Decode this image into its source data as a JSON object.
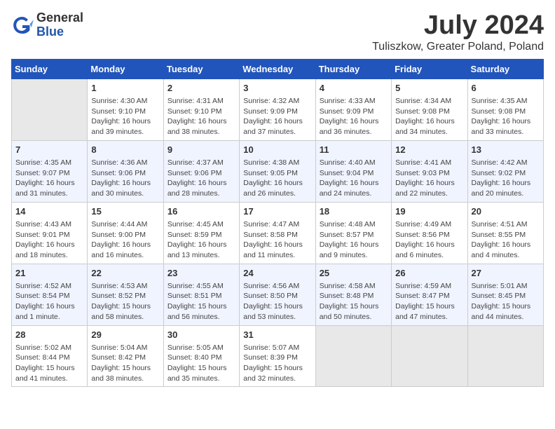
{
  "header": {
    "logo_general": "General",
    "logo_blue": "Blue",
    "month": "July 2024",
    "location": "Tuliszkow, Greater Poland, Poland"
  },
  "columns": [
    "Sunday",
    "Monday",
    "Tuesday",
    "Wednesday",
    "Thursday",
    "Friday",
    "Saturday"
  ],
  "weeks": [
    [
      {
        "day": "",
        "info": ""
      },
      {
        "day": "1",
        "info": "Sunrise: 4:30 AM\nSunset: 9:10 PM\nDaylight: 16 hours\nand 39 minutes."
      },
      {
        "day": "2",
        "info": "Sunrise: 4:31 AM\nSunset: 9:10 PM\nDaylight: 16 hours\nand 38 minutes."
      },
      {
        "day": "3",
        "info": "Sunrise: 4:32 AM\nSunset: 9:09 PM\nDaylight: 16 hours\nand 37 minutes."
      },
      {
        "day": "4",
        "info": "Sunrise: 4:33 AM\nSunset: 9:09 PM\nDaylight: 16 hours\nand 36 minutes."
      },
      {
        "day": "5",
        "info": "Sunrise: 4:34 AM\nSunset: 9:08 PM\nDaylight: 16 hours\nand 34 minutes."
      },
      {
        "day": "6",
        "info": "Sunrise: 4:35 AM\nSunset: 9:08 PM\nDaylight: 16 hours\nand 33 minutes."
      }
    ],
    [
      {
        "day": "7",
        "info": "Sunrise: 4:35 AM\nSunset: 9:07 PM\nDaylight: 16 hours\nand 31 minutes."
      },
      {
        "day": "8",
        "info": "Sunrise: 4:36 AM\nSunset: 9:06 PM\nDaylight: 16 hours\nand 30 minutes."
      },
      {
        "day": "9",
        "info": "Sunrise: 4:37 AM\nSunset: 9:06 PM\nDaylight: 16 hours\nand 28 minutes."
      },
      {
        "day": "10",
        "info": "Sunrise: 4:38 AM\nSunset: 9:05 PM\nDaylight: 16 hours\nand 26 minutes."
      },
      {
        "day": "11",
        "info": "Sunrise: 4:40 AM\nSunset: 9:04 PM\nDaylight: 16 hours\nand 24 minutes."
      },
      {
        "day": "12",
        "info": "Sunrise: 4:41 AM\nSunset: 9:03 PM\nDaylight: 16 hours\nand 22 minutes."
      },
      {
        "day": "13",
        "info": "Sunrise: 4:42 AM\nSunset: 9:02 PM\nDaylight: 16 hours\nand 20 minutes."
      }
    ],
    [
      {
        "day": "14",
        "info": "Sunrise: 4:43 AM\nSunset: 9:01 PM\nDaylight: 16 hours\nand 18 minutes."
      },
      {
        "day": "15",
        "info": "Sunrise: 4:44 AM\nSunset: 9:00 PM\nDaylight: 16 hours\nand 16 minutes."
      },
      {
        "day": "16",
        "info": "Sunrise: 4:45 AM\nSunset: 8:59 PM\nDaylight: 16 hours\nand 13 minutes."
      },
      {
        "day": "17",
        "info": "Sunrise: 4:47 AM\nSunset: 8:58 PM\nDaylight: 16 hours\nand 11 minutes."
      },
      {
        "day": "18",
        "info": "Sunrise: 4:48 AM\nSunset: 8:57 PM\nDaylight: 16 hours\nand 9 minutes."
      },
      {
        "day": "19",
        "info": "Sunrise: 4:49 AM\nSunset: 8:56 PM\nDaylight: 16 hours\nand 6 minutes."
      },
      {
        "day": "20",
        "info": "Sunrise: 4:51 AM\nSunset: 8:55 PM\nDaylight: 16 hours\nand 4 minutes."
      }
    ],
    [
      {
        "day": "21",
        "info": "Sunrise: 4:52 AM\nSunset: 8:54 PM\nDaylight: 16 hours\nand 1 minute."
      },
      {
        "day": "22",
        "info": "Sunrise: 4:53 AM\nSunset: 8:52 PM\nDaylight: 15 hours\nand 58 minutes."
      },
      {
        "day": "23",
        "info": "Sunrise: 4:55 AM\nSunset: 8:51 PM\nDaylight: 15 hours\nand 56 minutes."
      },
      {
        "day": "24",
        "info": "Sunrise: 4:56 AM\nSunset: 8:50 PM\nDaylight: 15 hours\nand 53 minutes."
      },
      {
        "day": "25",
        "info": "Sunrise: 4:58 AM\nSunset: 8:48 PM\nDaylight: 15 hours\nand 50 minutes."
      },
      {
        "day": "26",
        "info": "Sunrise: 4:59 AM\nSunset: 8:47 PM\nDaylight: 15 hours\nand 47 minutes."
      },
      {
        "day": "27",
        "info": "Sunrise: 5:01 AM\nSunset: 8:45 PM\nDaylight: 15 hours\nand 44 minutes."
      }
    ],
    [
      {
        "day": "28",
        "info": "Sunrise: 5:02 AM\nSunset: 8:44 PM\nDaylight: 15 hours\nand 41 minutes."
      },
      {
        "day": "29",
        "info": "Sunrise: 5:04 AM\nSunset: 8:42 PM\nDaylight: 15 hours\nand 38 minutes."
      },
      {
        "day": "30",
        "info": "Sunrise: 5:05 AM\nSunset: 8:40 PM\nDaylight: 15 hours\nand 35 minutes."
      },
      {
        "day": "31",
        "info": "Sunrise: 5:07 AM\nSunset: 8:39 PM\nDaylight: 15 hours\nand 32 minutes."
      },
      {
        "day": "",
        "info": ""
      },
      {
        "day": "",
        "info": ""
      },
      {
        "day": "",
        "info": ""
      }
    ]
  ]
}
